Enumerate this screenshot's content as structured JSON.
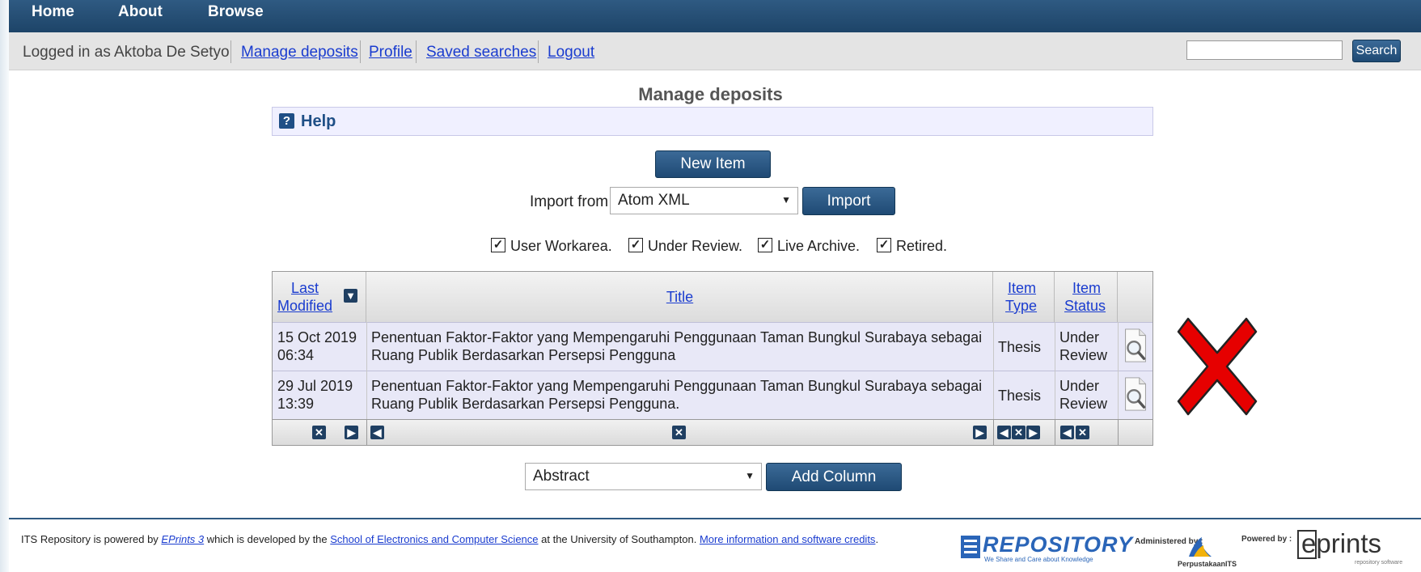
{
  "nav": {
    "home": "Home",
    "about": "About",
    "browse": "Browse"
  },
  "userbar": {
    "logged_in": "Logged in as Aktoba De Setyo",
    "links": [
      "Manage deposits",
      "Profile",
      "Saved searches",
      "Logout"
    ],
    "search_value": "",
    "search_button": "Search"
  },
  "page": {
    "title": "Manage deposits",
    "help": "Help"
  },
  "actions": {
    "new_item": "New Item",
    "import_from": "Import from",
    "import_format": "Atom XML",
    "import_button": "Import"
  },
  "filters": [
    "User Workarea.",
    "Under Review.",
    "Live Archive.",
    "Retired."
  ],
  "table": {
    "headers": {
      "last_modified": [
        "Last",
        "Modified"
      ],
      "title": "Title",
      "item_type": [
        "Item",
        "Type"
      ],
      "item_status": [
        "Item",
        "Status"
      ]
    },
    "rows": [
      {
        "date": "15 Oct 2019",
        "time": "06:34",
        "title_line1": "Penentuan Faktor-Faktor yang Mempengaruhi Penggunaan Taman Bungkul Surabaya sebagai",
        "title_line2": "Ruang Publik Berdasarkan Persepsi Pengguna",
        "type": "Thesis",
        "status_line1": "Under",
        "status_line2": "Review"
      },
      {
        "date": "29 Jul 2019",
        "time": "13:39",
        "title_line1": "Penentuan Faktor-Faktor yang Mempengaruhi Penggunaan Taman Bungkul Surabaya sebagai",
        "title_line2": "Ruang Publik Berdasarkan Persepsi Pengguna.",
        "type": "Thesis",
        "status_line1": "Under",
        "status_line2": "Review"
      }
    ]
  },
  "add_column": {
    "select_value": "Abstract",
    "button": "Add Column"
  },
  "footer": {
    "text1": "ITS Repository is powered by ",
    "eprints_link": "EPrints 3",
    "text2": " which is developed by the ",
    "school_link": "School of Electronics and Computer Science",
    "text3": " at the University of Southampton. ",
    "more_link": "More information and software credits",
    "text4": ".",
    "repo_logo": "REPOSITORY",
    "repo_tagline": "We Share and Care about Knowledge",
    "administered_by": "Administered by :",
    "perpustakaan": "PerpustakaanITS",
    "powered_by": "Powered by :",
    "eprints_logo": "eprints",
    "eprints_tagline": "repository software"
  },
  "colors": {
    "nav_bg": "#1d4468",
    "button_bg": "#2b5a87",
    "link": "#1a3ccf",
    "row_bg": "#e8e8f7",
    "reject_mark": "#e60000"
  }
}
